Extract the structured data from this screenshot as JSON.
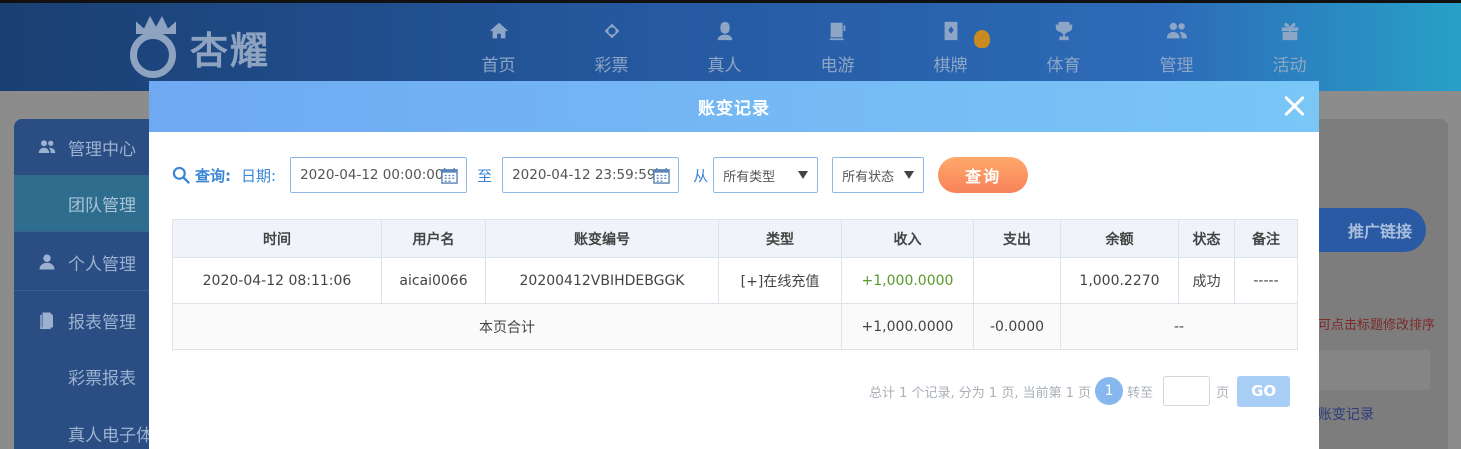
{
  "brand": {
    "name": "杏耀"
  },
  "nav": [
    {
      "label": "首页",
      "icon": "home-icon"
    },
    {
      "label": "彩票",
      "icon": "lottery-icon"
    },
    {
      "label": "真人",
      "icon": "live-dealer-icon"
    },
    {
      "label": "电游",
      "icon": "slot-machine-icon"
    },
    {
      "label": "棋牌",
      "icon": "cards-icon"
    },
    {
      "label": "体育",
      "icon": "trophy-icon"
    },
    {
      "label": "管理",
      "icon": "users-icon"
    },
    {
      "label": "活动",
      "icon": "gift-icon"
    }
  ],
  "sidebar": {
    "items": [
      {
        "label": "管理中心",
        "icon": "users-icon"
      },
      {
        "label": "团队管理"
      },
      {
        "label": "个人管理",
        "icon": "user-icon"
      },
      {
        "label": "报表管理",
        "icon": "report-icon"
      },
      {
        "label": "彩票报表"
      },
      {
        "label": "真人电子体"
      }
    ]
  },
  "background": {
    "promo_button": "推广链接",
    "hint": "可点击标题修改排序",
    "link": "账变记录"
  },
  "modal": {
    "title": "账变记录",
    "filter": {
      "query_label": "查询:",
      "date_label": "日期:",
      "start_date": "2020-04-12 00:00:00",
      "separator": "至",
      "end_date": "2020-04-12 23:59:59",
      "from_label": "从",
      "type_select": "所有类型",
      "status_select": "所有状态",
      "search_button": "查询"
    },
    "table": {
      "headers": [
        "时间",
        "用户名",
        "账变编号",
        "类型",
        "收入",
        "支出",
        "余额",
        "状态",
        "备注"
      ],
      "rows": [
        [
          "2020-04-12 08:11:06",
          "aicai0066",
          "20200412VBIHDEBGGK",
          "[+]在线充值",
          "+1,000.0000",
          "",
          "1,000.2270",
          "成功",
          "-----"
        ]
      ],
      "total": {
        "label": "本页合计",
        "income": "+1,000.0000",
        "expense": "-0.0000",
        "rest": "--"
      }
    },
    "pager": {
      "summary": "总计 1 个记录, 分为 1 页, 当前第 1 页",
      "current_page": "1",
      "goto_label": "转至",
      "page_unit": "页",
      "go_button": "GO"
    }
  },
  "colors": {
    "accent_blue": "#3a86d6",
    "income_green": "#5a9a2a",
    "search_orange": "#f7825a"
  }
}
